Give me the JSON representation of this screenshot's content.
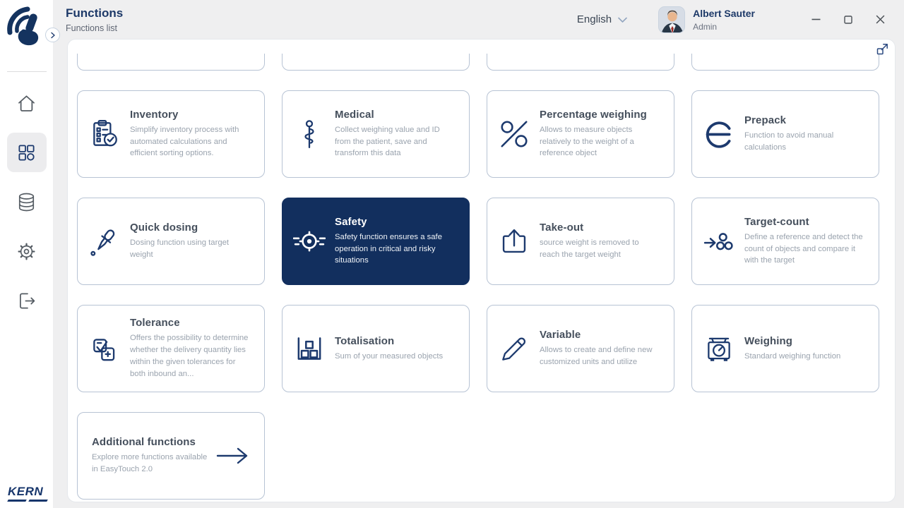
{
  "header": {
    "title": "Functions",
    "subtitle": "Functions list",
    "language_selector": {
      "value": "English",
      "icon": "chevron-down-icon"
    },
    "user": {
      "name": "Albert Sauter",
      "role": "Admin",
      "avatar_icon": "avatar-photo"
    },
    "window_controls": [
      {
        "id": "minimize",
        "icon": "minimize-icon"
      },
      {
        "id": "maximize",
        "icon": "maximize-icon"
      },
      {
        "id": "close",
        "icon": "close-icon"
      }
    ]
  },
  "sidebar": {
    "brand_icon": "easytouch-hand-logo",
    "collapse_icon": "chevron-right-icon",
    "items": [
      {
        "id": "home",
        "icon": "home-icon",
        "active": false
      },
      {
        "id": "functions",
        "icon": "apps-grid-icon",
        "active": true
      },
      {
        "id": "database",
        "icon": "database-icon",
        "active": false
      },
      {
        "id": "settings",
        "icon": "gear-icon",
        "active": false
      },
      {
        "id": "logout",
        "icon": "logout-icon",
        "active": false
      }
    ],
    "footer_logo_text": "KERN"
  },
  "panel": {
    "expand_icon": "expand-icon"
  },
  "grid": {
    "cut_off_cards_count": 4,
    "cards": [
      {
        "id": "inventory",
        "title": "Inventory",
        "description": "Simplify inventory process with automated calculations and efficient sorting options.",
        "icon": "inventory-icon",
        "selected": false
      },
      {
        "id": "medical",
        "title": "Medical",
        "description": "Collect weighing value and ID from the patient, save and transform this data",
        "icon": "medical-icon",
        "selected": false
      },
      {
        "id": "percentage-weighing",
        "title": "Percentage weighing",
        "description": "Allows to measure objects relatively to the weight of a reference object",
        "icon": "percent-icon",
        "selected": false
      },
      {
        "id": "prepack",
        "title": "Prepack",
        "description": "Function to avoid manual calculations",
        "icon": "estimated-e-icon",
        "selected": false
      },
      {
        "id": "quick-dosing",
        "title": "Quick dosing",
        "description": "Dosing function using target weight",
        "icon": "pipette-icon",
        "selected": false
      },
      {
        "id": "safety",
        "title": "Safety",
        "description": "Safety function ensures a safe operation in critical and risky situations",
        "icon": "safety-target-icon",
        "selected": true
      },
      {
        "id": "take-out",
        "title": "Take-out",
        "description": "source weight is removed to reach the target weight",
        "icon": "take-out-icon",
        "selected": false
      },
      {
        "id": "target-count",
        "title": "Target-count",
        "description": "Define a reference and detect the count of objects and compare it with the target",
        "icon": "target-count-icon",
        "selected": false
      },
      {
        "id": "tolerance",
        "title": "Tolerance",
        "description": "Offers the possibility to determine whether the delivery quantity lies within the given tolerances for both inbound an...",
        "icon": "tolerance-icon",
        "selected": false
      },
      {
        "id": "totalisation",
        "title": "Totalisation",
        "description": "Sum of your measured objects",
        "icon": "totalisation-icon",
        "selected": false
      },
      {
        "id": "variable",
        "title": "Variable",
        "description": "Allows to create and define new customized units and utilize",
        "icon": "pencil-icon",
        "selected": false
      },
      {
        "id": "weighing",
        "title": "Weighing",
        "description": "Standard weighing function",
        "icon": "scale-icon",
        "selected": false
      }
    ],
    "extra_card": {
      "id": "additional-functions",
      "title": "Additional functions",
      "description": "Explore more functions available in EasyTouch 2.0",
      "icon": "arrow-right-icon"
    }
  },
  "colors": {
    "brand_navy": "#16356b",
    "selected_card_bg": "#122f5e",
    "card_border": "#b7c3d4",
    "title_text": "#454f5c",
    "description_text": "#9aa3ae",
    "header_bg": "#efeff0"
  }
}
